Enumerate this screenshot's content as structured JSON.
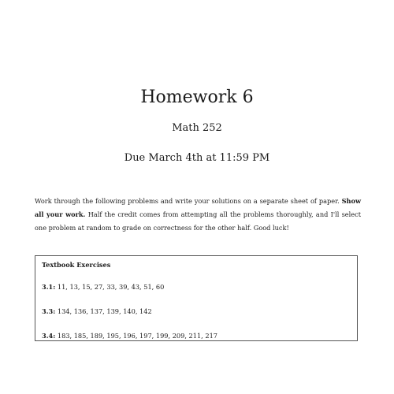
{
  "document": {
    "title": "Homework 6",
    "course": "Math 252",
    "due": "Due March 4th at 11:59 PM",
    "intro": {
      "before_bold": "Work through the following problems and write your solutions on a separate sheet of paper. ",
      "bold": "Show all your work.",
      "after_bold": " Half the credit comes from attempting all the problems thoroughly, and I'll select one problem at random to grade on correctness for the other half. Good luck!"
    },
    "exercises": {
      "heading": "Textbook Exercises",
      "sections": [
        {
          "section": "3.1:",
          "problems": "11, 13, 15, 27, 33, 39, 43, 51, 60"
        },
        {
          "section": "3.3:",
          "problems": "134, 136, 137, 139, 140, 142"
        },
        {
          "section": "3.4:",
          "problems": "183, 185, 189, 195, 196, 197, 199, 209, 211, 217"
        }
      ]
    }
  }
}
